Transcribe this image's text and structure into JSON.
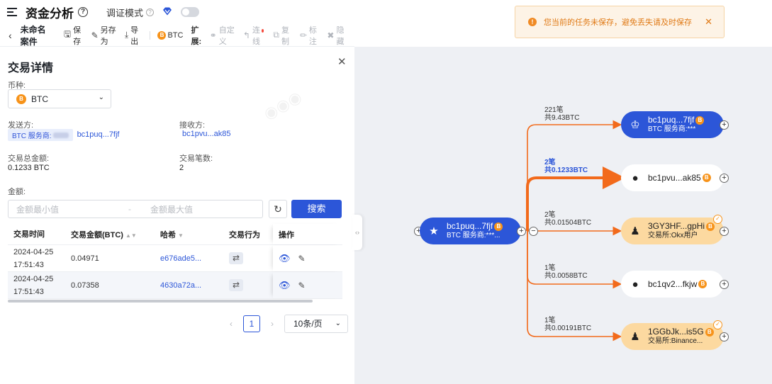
{
  "header": {
    "title": "资金分析",
    "debug_mode_label": "调证模式"
  },
  "toolbar": {
    "case_name": "未命名案件",
    "save": "保存",
    "save_as": "另存为",
    "export": "导出",
    "currency": "BTC",
    "extend_label": "扩展:",
    "custom": "自定义",
    "connect": "连线",
    "copy": "复制",
    "annotate": "标注",
    "hide": "隐藏"
  },
  "toast": {
    "message": "您当前的任务未保存，避免丢失请及时保存"
  },
  "panel": {
    "title": "交易详情",
    "currency_label": "币种:",
    "currency_value": "BTC",
    "sender_label": "发送方:",
    "sender_tag": "BTC 服务商:",
    "sender_addr": "bc1puq...7fjf",
    "receiver_label": "接收方:",
    "receiver_addr": "bc1pvu...ak85",
    "total_amount_label": "交易总金额:",
    "total_amount_value": "0.1233 BTC",
    "tx_count_label": "交易笔数:",
    "tx_count_value": "2",
    "amount_label": "金额:",
    "min_placeholder": "金额最小值",
    "max_placeholder": "金额最大值",
    "search_button": "搜索"
  },
  "table": {
    "headers": {
      "time": "交易时间",
      "amount": "交易金额(BTC)",
      "hash": "哈希",
      "behavior": "交易行为",
      "action": "操作"
    },
    "rows": [
      {
        "date": "2024-04-25",
        "time": "17:51:43",
        "amount": "0.04971",
        "hash": "e676ade5..."
      },
      {
        "date": "2024-04-25",
        "time": "17:51:43",
        "amount": "0.07358",
        "hash": "4630a72a..."
      }
    ]
  },
  "pagination": {
    "current_page": "1",
    "page_size": "10条/页"
  },
  "graph": {
    "source": {
      "main": "bc1puq...7fjf",
      "sub": "BTC 服务商:***..."
    },
    "targets": [
      {
        "main": "bc1puq...7fjf",
        "sub": "BTC 服务商:***",
        "edge_count": "221笔",
        "edge_total": "共9.43BTC"
      },
      {
        "main": "bc1pvu...ak85",
        "sub": "",
        "edge_count": "2笔",
        "edge_total": "共0.1233BTC"
      },
      {
        "main": "3GY3HF...gpHi",
        "sub": "交易所:Okx用户",
        "edge_count": "2笔",
        "edge_total": "共0.01504BTC"
      },
      {
        "main": "bc1qv2...fkjw",
        "sub": "",
        "edge_count": "1笔",
        "edge_total": "共0.0058BTC"
      },
      {
        "main": "1GGbJk...is5G",
        "sub": "交易所:Binance...",
        "edge_count": "1笔",
        "edge_total": "共0.00191BTC"
      }
    ]
  },
  "colors": {
    "primary": "#2c56d8",
    "edge": "#f26a1b",
    "exchange_node": "#fcd9a0",
    "btc": "#f7931a"
  }
}
